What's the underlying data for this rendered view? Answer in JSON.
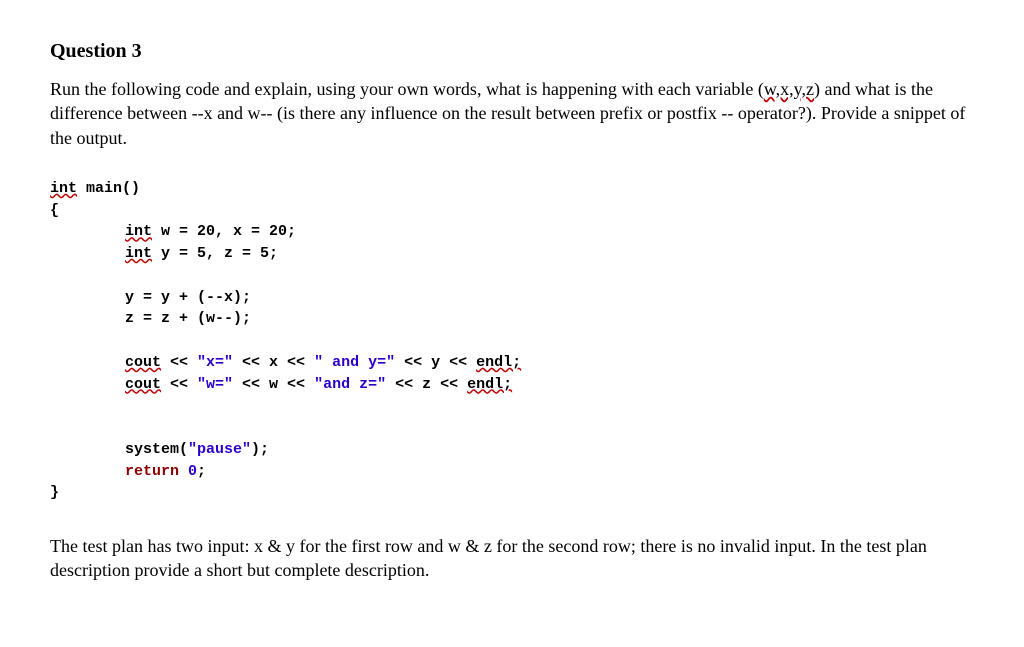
{
  "title": "Question 3",
  "instructions_pre": "Run the following code and explain, using your own words, what is happening with each variable (",
  "instructions_underlined": "w,x,y,z",
  "instructions_post": ") and what is the difference between --x  and w-- (is there any influence on the result between prefix or postfix -- operator?). Provide a snippet of the output.",
  "code": {
    "l1_kw": "int",
    "l1_rest": " main()",
    "l2": "{",
    "l3_kw": "int",
    "l3_rest": " w = 20, x = 20;",
    "l4_kw": "int",
    "l4_rest": " y = 5, z = 5;",
    "l5": "y = y + (--x);",
    "l6": "z = z + (w--);",
    "l7_kw": "cout",
    "l7_a": " << ",
    "l7_s1": "\"x=\"",
    "l7_b": " << x << ",
    "l7_s2": "\" and y=\"",
    "l7_c": " << y << ",
    "l7_kw2": "endl;",
    "l8_kw": "cout",
    "l8_a": " << ",
    "l8_s1": "\"w=\"",
    "l8_b": " << w << ",
    "l8_s2": "\"and z=\"",
    "l8_c": " << z << ",
    "l8_kw2": "endl;",
    "l9a": "system(",
    "l9s": "\"pause\"",
    "l9b": ");",
    "l10_ret": "return",
    "l10_sp": " ",
    "l10_zero": "0",
    "l10_semi": ";",
    "l11": "}"
  },
  "testplan": "The test plan has two input: x & y for the first row and w & z for the second row; there is no invalid input.  In the test plan description provide a short but complete description."
}
